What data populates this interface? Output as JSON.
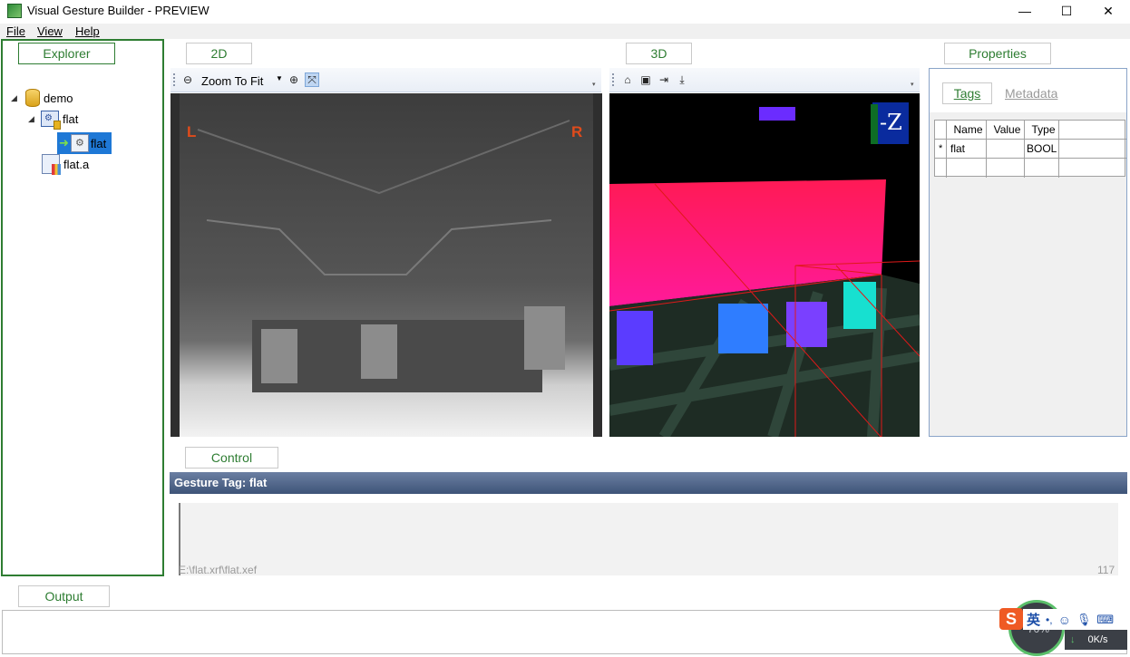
{
  "window": {
    "title": "Visual Gesture Builder - PREVIEW",
    "minimize_glyph": "—",
    "maximize_glyph": "☐",
    "close_glyph": "✕"
  },
  "menu": {
    "file": "File",
    "view": "View",
    "help": "Help"
  },
  "explorer": {
    "tab_label": "Explorer",
    "tree": {
      "root": "demo",
      "child": "flat",
      "grandchild": "flat",
      "sibling": "flat.a"
    }
  },
  "view2d": {
    "tab_label": "2D",
    "zoom_label": "Zoom To Fit",
    "left_marker": "L",
    "right_marker": "R"
  },
  "view3d": {
    "tab_label": "3D",
    "axis_cube_label": "-Z"
  },
  "properties": {
    "tab_label": "Properties",
    "subtabs": {
      "tags": "Tags",
      "metadata": "Metadata"
    },
    "columns": {
      "name": "Name",
      "value": "Value",
      "type": "Type"
    },
    "rows": [
      {
        "marker": "*",
        "name": "flat",
        "value": "",
        "type": "BOOL"
      }
    ]
  },
  "control": {
    "tab_label": "Control",
    "gesture_tag": "Gesture Tag: flat",
    "file_path": "E:\\flat.xrf\\flat.xef",
    "frame_count": "117"
  },
  "output": {
    "tab_label": "Output"
  },
  "tray": {
    "ime_label": "英",
    "net_speed": "0K/s",
    "percent": "70%"
  },
  "colors": {
    "accent_green": "#2e7d32",
    "control_header": "#4f6488",
    "selection": "#1e78d6"
  }
}
